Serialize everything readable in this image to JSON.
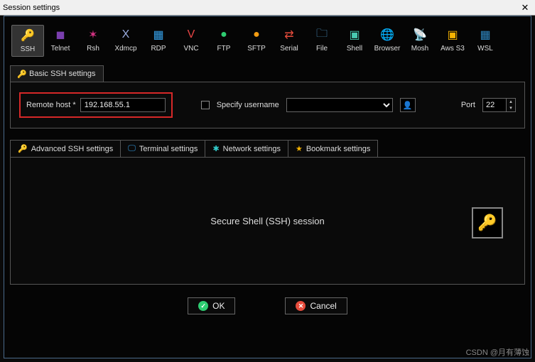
{
  "window": {
    "title": "Session settings"
  },
  "session_types": [
    {
      "label": "SSH",
      "icon": "🔑",
      "color": "#f5b301",
      "selected": true
    },
    {
      "label": "Telnet",
      "icon": "◼",
      "color": "#7a3fae"
    },
    {
      "label": "Rsh",
      "icon": "✶",
      "color": "#d63384"
    },
    {
      "label": "Xdmcp",
      "icon": "X",
      "color": "#9ad"
    },
    {
      "label": "RDP",
      "icon": "▦",
      "color": "#36a2eb"
    },
    {
      "label": "VNC",
      "icon": "V",
      "color": "#e84545"
    },
    {
      "label": "FTP",
      "icon": "●",
      "color": "#2ecc71"
    },
    {
      "label": "SFTP",
      "icon": "●",
      "color": "#f39c12"
    },
    {
      "label": "Serial",
      "icon": "⇄",
      "color": "#e74c3c"
    },
    {
      "label": "File",
      "icon": "🗀",
      "color": "#5dade2"
    },
    {
      "label": "Shell",
      "icon": "▣",
      "color": "#48c9b0"
    },
    {
      "label": "Browser",
      "icon": "🌐",
      "color": "#2e86c1"
    },
    {
      "label": "Mosh",
      "icon": "📡",
      "color": "#5d6d7e"
    },
    {
      "label": "Aws S3",
      "icon": "▣",
      "color": "#f5b301"
    },
    {
      "label": "WSL",
      "icon": "▦",
      "color": "#2e86c1"
    }
  ],
  "basic_tab": {
    "label": "Basic SSH settings"
  },
  "form": {
    "remote_host_label": "Remote host *",
    "remote_host_value": "192.168.55.1",
    "specify_username_label": "Specify username",
    "username_value": "",
    "port_label": "Port",
    "port_value": "22"
  },
  "sub_tabs": [
    {
      "label": "Advanced SSH settings",
      "icon": "🔑",
      "color": "#f5b301"
    },
    {
      "label": "Terminal settings",
      "icon": "🖵",
      "color": "#36a2eb"
    },
    {
      "label": "Network settings",
      "icon": "✱",
      "color": "#3cc"
    },
    {
      "label": "Bookmark settings",
      "icon": "★",
      "color": "#f5b301"
    }
  ],
  "session_description": "Secure Shell (SSH) session",
  "buttons": {
    "ok": "OK",
    "cancel": "Cancel"
  },
  "watermark": "CSDN @月有薄蚀"
}
